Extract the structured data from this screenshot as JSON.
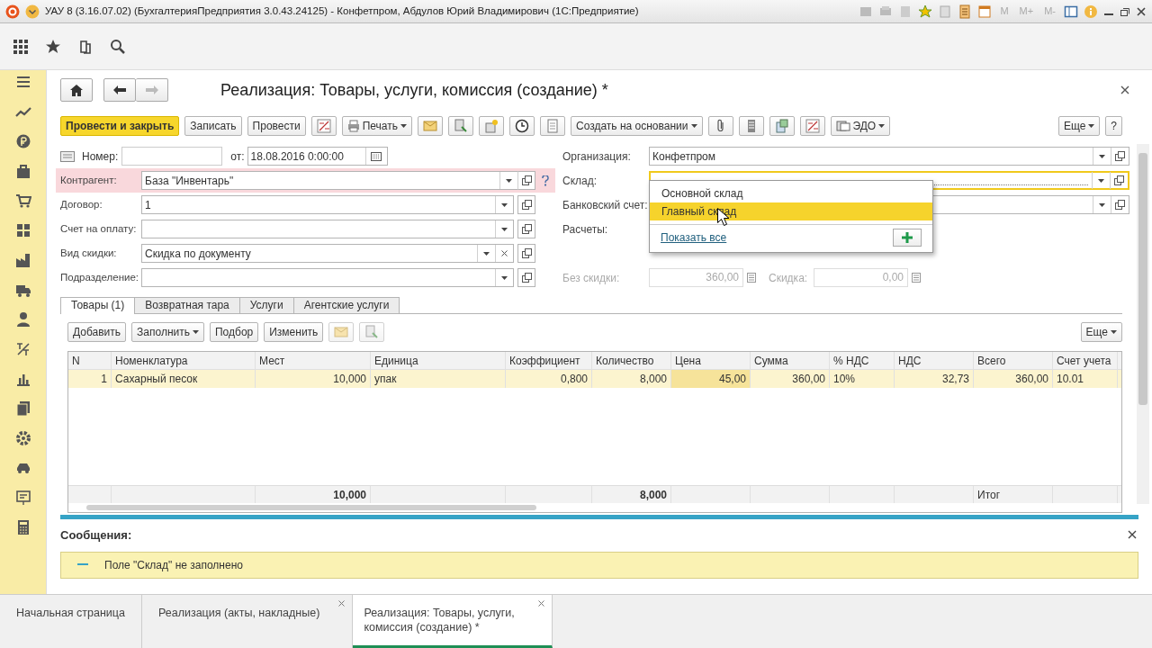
{
  "window": {
    "title": "УАУ 8 (3.16.07.02) (БухгалтерияПредприятия 3.0.43.24125) - Конфетпром, Абдулов Юрий Владимирович  (1С:Предприятие)",
    "memory_keys": [
      "M",
      "M+",
      "M-"
    ]
  },
  "form": {
    "title": "Реализация: Товары, услуги, комиссия (создание) *",
    "command_bar": [
      {
        "kind": "primary",
        "label": "Провести и закрыть"
      },
      {
        "kind": "button",
        "label": "Записать"
      },
      {
        "kind": "button",
        "label": "Провести"
      },
      {
        "kind": "icon"
      },
      {
        "kind": "menu",
        "label": "Печать"
      },
      {
        "kind": "icon"
      },
      {
        "kind": "icon"
      },
      {
        "kind": "icon"
      },
      {
        "kind": "icon"
      },
      {
        "kind": "icon"
      },
      {
        "kind": "menu",
        "label": "Создать на основании"
      },
      {
        "kind": "icon"
      },
      {
        "kind": "icon"
      },
      {
        "kind": "icon"
      },
      {
        "kind": "icon"
      },
      {
        "kind": "menu",
        "label": "ЭДО"
      }
    ],
    "command_bar_right": [
      {
        "kind": "menu",
        "label": "Еще"
      },
      {
        "kind": "button",
        "label": "?"
      }
    ],
    "number": {
      "label": "Номер:",
      "date_label": "от:",
      "date": "18.08.2016 0:00:00"
    },
    "left_fields": [
      {
        "label": "Контрагент:",
        "value": "База \"Инвентарь\"",
        "error": true,
        "clearable": false
      },
      {
        "label": "Договор:",
        "value": "1",
        "error": false,
        "clearable": false
      },
      {
        "label": "Счет на оплату:",
        "error": false,
        "clearable": false
      },
      {
        "label": "Вид скидки:",
        "value": "Скидка по документу",
        "error": false,
        "clearable": true
      },
      {
        "label": "Подразделение:",
        "error": false,
        "clearable": false
      }
    ],
    "right_fields": [
      {
        "kind": "select",
        "label": "Организация:",
        "value": "Конфетпром",
        "focused": false
      },
      {
        "kind": "select",
        "label": "Склад:",
        "focused": true
      },
      {
        "kind": "select",
        "label": "Банковский счет:",
        "focused": false
      },
      {
        "kind": "label",
        "label": "Расчеты:"
      }
    ],
    "amounts": [
      {
        "label": "Без скидки:",
        "value": "360,00",
        "disabled": true
      },
      {
        "label": "Скидка:",
        "value": "0,00",
        "disabled": true
      }
    ],
    "dropdown": {
      "items": [
        {
          "text": "Основной склад",
          "selected": false
        },
        {
          "text": "Главный склад",
          "selected": true
        }
      ],
      "show_all": "Показать все"
    },
    "tabs": [
      {
        "label": "Товары (1)",
        "selected": true
      },
      {
        "label": "Возвратная тара",
        "selected": false
      },
      {
        "label": "Услуги",
        "selected": false
      },
      {
        "label": "Агентские услуги",
        "selected": false
      }
    ],
    "table_toolbar": [
      {
        "kind": "button",
        "label": "Добавить"
      },
      {
        "kind": "menu",
        "label": "Заполнить"
      },
      {
        "kind": "button",
        "label": "Подбор"
      },
      {
        "kind": "button",
        "label": "Изменить"
      },
      {
        "kind": "icon",
        "disabled": true
      },
      {
        "kind": "icon",
        "disabled": true
      }
    ],
    "table_toolbar_right": {
      "kind": "menu",
      "label": "Еще"
    },
    "table": {
      "columns": [
        {
          "title": "N",
          "current": false
        },
        {
          "title": "Номенклатура",
          "current": false
        },
        {
          "title": "Мест",
          "current": false,
          "total": "10,000"
        },
        {
          "title": "Единица",
          "current": false
        },
        {
          "title": "Коэффициент",
          "current": false
        },
        {
          "title": "Количество",
          "current": false,
          "total": "8,000"
        },
        {
          "title": "Цена",
          "current": true
        },
        {
          "title": "Сумма",
          "current": false
        },
        {
          "title": "% НДС",
          "current": false
        },
        {
          "title": "НДС",
          "current": false
        },
        {
          "title": "Всего",
          "current": false,
          "total": "Итог"
        },
        {
          "title": "Счет учета",
          "current": false
        }
      ],
      "rows": [
        {
          "selected": true,
          "cells": [
            "1",
            "Сахарный песок",
            "10,000",
            "упак",
            "0,800",
            "8,000",
            "45,00",
            "360,00",
            "10%",
            "32,73",
            "360,00",
            "10.01"
          ]
        }
      ]
    }
  },
  "messages": {
    "title": "Сообщения:",
    "items": [
      "Поле \"Склад\" не заполнено"
    ]
  },
  "open_tabs": [
    {
      "label": "Начальная страница",
      "selected": false,
      "closable": false
    },
    {
      "label": "Реализация (акты, накладные)",
      "selected": false,
      "closable": true
    },
    {
      "label": "Реализация: Товары, услуги, комиссия (создание) *",
      "selected": true,
      "closable": true
    }
  ]
}
